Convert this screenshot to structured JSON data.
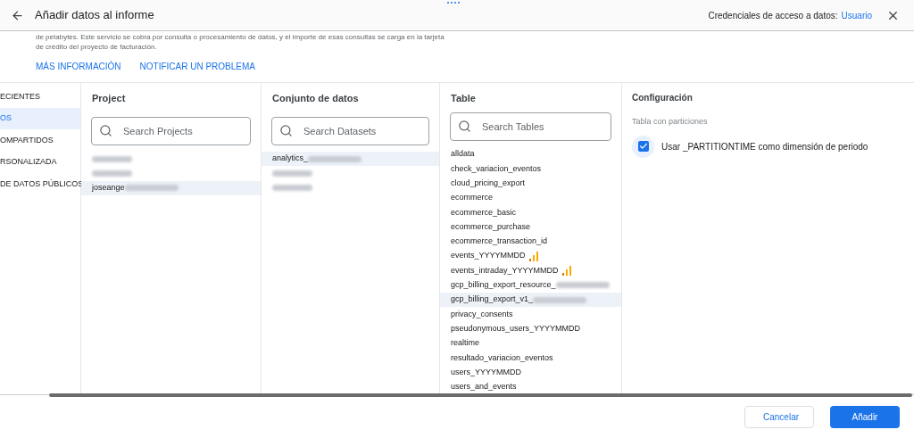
{
  "header": {
    "title": "Añadir datos al informe",
    "credentials_label": "Credenciales de acceso a datos:",
    "credentials_link": "Usuario"
  },
  "notice": {
    "lines": [
      "de petabytes. Este servicio se cobra por consulta o procesamiento de datos, y el importe de esas consultas se carga en la tarjeta",
      "de crédito del proyecto de facturación."
    ],
    "links": [
      "MÁS INFORMACIÓN",
      "NOTIFICAR UN PROBLEMA"
    ]
  },
  "sidebar": {
    "items": [
      {
        "label": "ECIENTES",
        "selected": false
      },
      {
        "label": "OS",
        "selected": true
      },
      {
        "label": "OMPARTIDOS",
        "selected": false
      },
      {
        "label": "RSONALIZADA",
        "selected": false
      },
      {
        "label": "DE DATOS PÚBLICOS",
        "selected": false
      }
    ]
  },
  "columns": [
    {
      "title": "Project",
      "search_placeholder": "Search Projects",
      "items": [
        {
          "redacted": true,
          "selected": false
        },
        {
          "redacted": true,
          "selected": false
        },
        {
          "text": "joseange",
          "redacted": true,
          "selected": true
        }
      ]
    },
    {
      "title": "Conjunto de datos",
      "search_placeholder": "Search Datasets",
      "items": [
        {
          "text": "analytics_",
          "redacted": true,
          "selected": true
        },
        {
          "redacted": true,
          "selected": false
        },
        {
          "redacted": true,
          "selected": false
        }
      ]
    },
    {
      "title": "Table",
      "search_placeholder": "Search Tables",
      "items": [
        {
          "text": "alldata",
          "selected": false
        },
        {
          "text": "check_variacion_eventos",
          "selected": false
        },
        {
          "text": "cloud_pricing_export",
          "selected": false
        },
        {
          "text": "ecommerce",
          "selected": false
        },
        {
          "text": "ecommerce_basic",
          "selected": false
        },
        {
          "text": "ecommerce_purchase",
          "selected": false
        },
        {
          "text": "ecommerce_transaction_id",
          "selected": false
        },
        {
          "text": "events_YYYYMMDD",
          "analytics": true,
          "selected": false
        },
        {
          "text": "events_intraday_YYYYMMDD",
          "analytics": true,
          "selected": false
        },
        {
          "text": "gcp_billing_export_resource_",
          "redacted": true,
          "selected": false
        },
        {
          "text": "gcp_billing_export_v1_",
          "redacted": true,
          "selected": true
        },
        {
          "text": "privacy_consents",
          "selected": false
        },
        {
          "text": "pseudonymous_users_YYYYMMDD",
          "selected": false
        },
        {
          "text": "realtime",
          "selected": false
        },
        {
          "text": "resultado_variacion_eventos",
          "selected": false
        },
        {
          "text": "users_YYYYMMDD",
          "selected": false
        },
        {
          "text": "users_and_events",
          "selected": false
        }
      ]
    }
  ],
  "configuration": {
    "title": "Configuración",
    "section": "Tabla con particiones",
    "option": {
      "label": "Usar _PARTITIONTIME como dimensión de periodo",
      "checked": true
    }
  },
  "footer": {
    "buttons": [
      {
        "label": "Cancelar",
        "kind": "secondary"
      },
      {
        "label": "Añadir",
        "kind": "primary"
      }
    ]
  }
}
